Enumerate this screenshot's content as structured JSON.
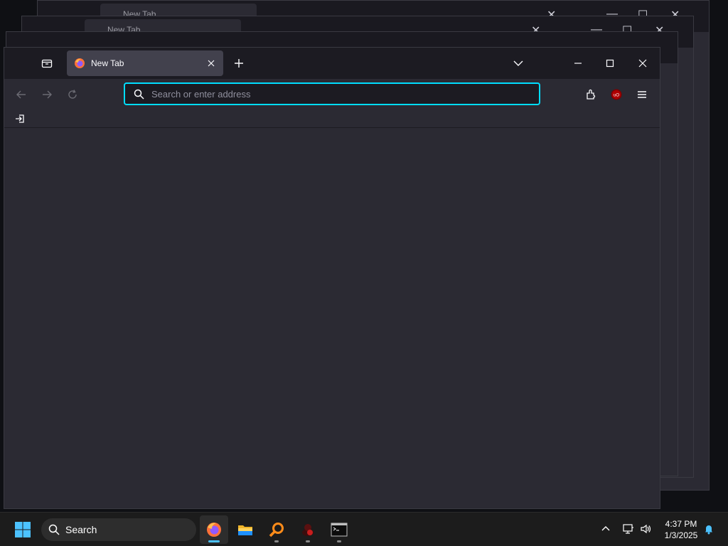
{
  "browser": {
    "tab": {
      "title": "New Tab"
    },
    "background_tab_title": "New Tab",
    "address_bar": {
      "placeholder": "Search or enter address",
      "value": ""
    },
    "accent_color": "#00ddff",
    "extension_badge": "uO"
  },
  "taskbar": {
    "search_label": "Search",
    "time": "4:37 PM",
    "date": "1/3/2025",
    "apps": [
      "firefox-icon",
      "file-explorer-icon",
      "search-app-icon",
      "ghidra-icon",
      "terminal-icon"
    ]
  }
}
